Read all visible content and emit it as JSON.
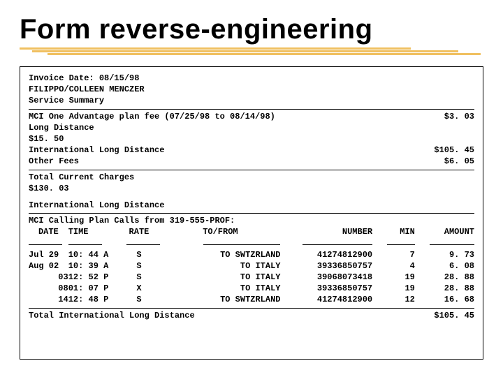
{
  "title": "Form reverse-engineering",
  "header": {
    "invoice_line": "Invoice Date: 08/15/98",
    "customer": "FILIPPO/COLLEEN MENCZER",
    "summary_label": "Service Summary"
  },
  "fees": [
    {
      "label": "MCI One Advantage plan fee (07/25/98 to 08/14/98)",
      "amount": "$3. 03"
    },
    {
      "label": "Long Distance",
      "amount": ""
    },
    {
      "label": "$15. 50",
      "amount": ""
    },
    {
      "label": "International Long Distance",
      "amount": "$105. 45"
    },
    {
      "label": "Other Fees",
      "amount": "$6. 05"
    }
  ],
  "total": {
    "label": "Total Current Charges",
    "amount": "$130. 03"
  },
  "section_ild": "International Long Distance",
  "calls_header": "MCI Calling Plan Calls from 319-555-PROF:",
  "columns": {
    "date": "DATE",
    "time": "TIME",
    "rate": "RATE",
    "tofrom": "TO/FROM",
    "number": "NUMBER",
    "min": "MIN",
    "amount": "AMOUNT"
  },
  "calls": [
    {
      "date": "Jul 29",
      "time": "10: 44 A",
      "rate": "S",
      "tofrom": "TO SWTZRLAND",
      "number": "41274812900",
      "min": "7",
      "amount": "9. 73"
    },
    {
      "date": "Aug 02",
      "time": "10: 39 A",
      "rate": "S",
      "tofrom": "TO ITALY",
      "number": "39336850757",
      "min": "4",
      "amount": "6. 08"
    },
    {
      "date": "03",
      "time": "12: 52 P",
      "rate": "S",
      "tofrom": "TO ITALY",
      "number": "39068073418",
      "min": "19",
      "amount": "28. 88"
    },
    {
      "date": "08",
      "time": "01: 07 P",
      "rate": "X",
      "tofrom": "TO ITALY",
      "number": "39336850757",
      "min": "19",
      "amount": "28. 88"
    },
    {
      "date": "14",
      "time": "12: 48 P",
      "rate": "S",
      "tofrom": "TO SWTZRLAND",
      "number": "41274812900",
      "min": "12",
      "amount": "16. 68"
    }
  ],
  "ild_total": {
    "label": "Total International Long Distance",
    "amount": "$105. 45"
  }
}
